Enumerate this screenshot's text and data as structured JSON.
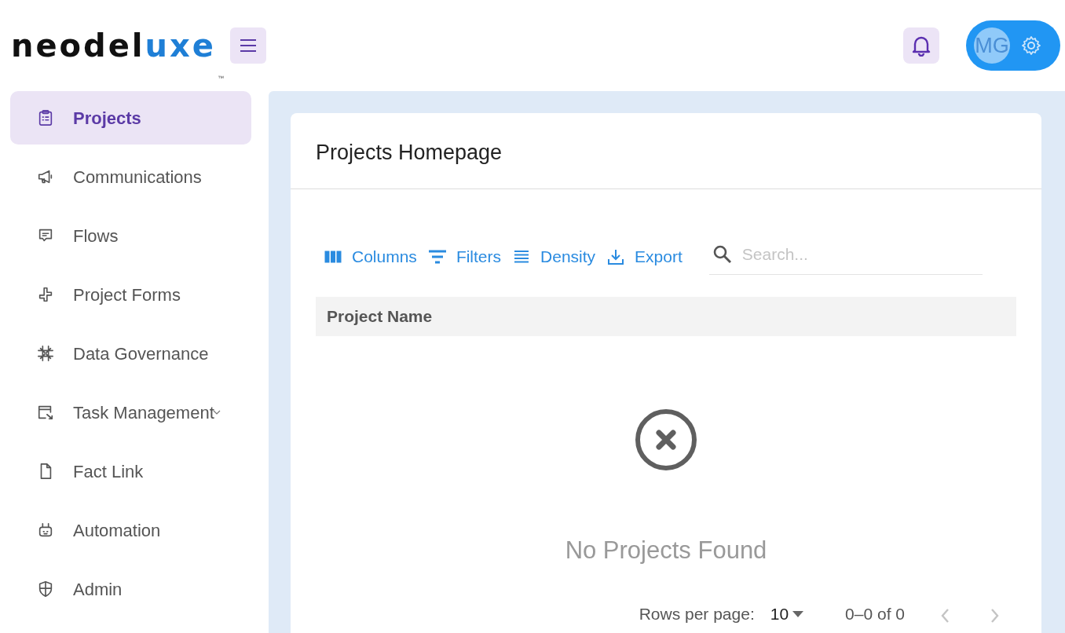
{
  "logo": {
    "parts": [
      {
        "text": "neodel",
        "accent": false
      },
      {
        "text": "uxe",
        "accent": true
      }
    ],
    "trademark": "™"
  },
  "user": {
    "initials": "MG"
  },
  "sidebar": {
    "items": [
      {
        "label": "Projects",
        "kind": "clipboard",
        "selected": true
      },
      {
        "label": "Communications",
        "kind": "megaphone",
        "selected": false
      },
      {
        "label": "Flows",
        "kind": "chat",
        "selected": false
      },
      {
        "label": "Project Forms",
        "kind": "forms",
        "selected": false
      },
      {
        "label": "Data Governance",
        "kind": "grid",
        "selected": false
      },
      {
        "label": "Task Management",
        "kind": "task",
        "selected": false,
        "expandable": true
      },
      {
        "label": "Fact Link",
        "kind": "file",
        "selected": false
      },
      {
        "label": "Automation",
        "kind": "robot",
        "selected": false
      },
      {
        "label": "Admin",
        "kind": "shield",
        "selected": false
      }
    ]
  },
  "card": {
    "title": "Projects Homepage",
    "toolbar": [
      {
        "label": "Columns",
        "kind": "columns"
      },
      {
        "label": "Filters",
        "kind": "filter"
      },
      {
        "label": "Density",
        "kind": "density"
      },
      {
        "label": "Export",
        "kind": "export"
      }
    ],
    "search": {
      "placeholder": "Search..."
    },
    "table": {
      "columns": [
        "Project Name"
      ]
    },
    "empty_message": "No Projects Found",
    "pagination": {
      "rows_label": "Rows per page:",
      "rows_value": "10",
      "range": "0–0 of 0",
      "prev_disabled": true,
      "next_disabled": true
    }
  }
}
